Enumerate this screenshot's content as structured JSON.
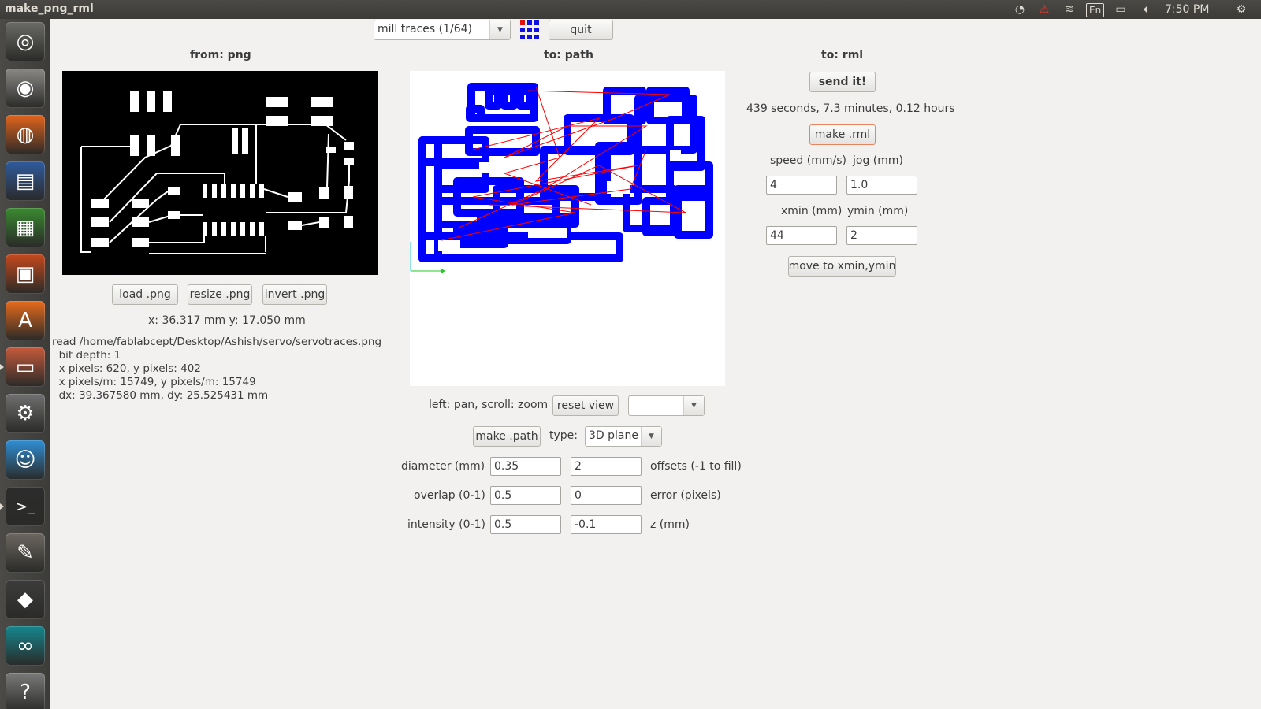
{
  "window": {
    "title": "make_png_rml"
  },
  "tray": {
    "language": "En",
    "clock": "7:50 PM"
  },
  "launcher": {
    "items": [
      {
        "name": "ubuntu-dash-icon",
        "glyph": "◎",
        "color": "#6a6a66"
      },
      {
        "name": "camera-icon",
        "glyph": "◉",
        "color": "#8a8986"
      },
      {
        "name": "firefox-icon",
        "glyph": "◍",
        "color": "#e2641c"
      },
      {
        "name": "writer-icon",
        "glyph": "▤",
        "color": "#2f5b9c"
      },
      {
        "name": "calc-icon",
        "glyph": "▦",
        "color": "#3a8a30"
      },
      {
        "name": "impress-icon",
        "glyph": "▣",
        "color": "#c4491c"
      },
      {
        "name": "software-center-icon",
        "glyph": "A",
        "color": "#e86b1c"
      },
      {
        "name": "file-manager-icon",
        "glyph": "▭",
        "color": "#c45a3c"
      },
      {
        "name": "system-settings-icon",
        "glyph": "⚙",
        "color": "#707070"
      },
      {
        "name": "chat-icon",
        "glyph": "☺",
        "color": "#2f8ed4"
      },
      {
        "name": "terminal-icon",
        "glyph": ">_",
        "color": "#2c2c2c"
      },
      {
        "name": "gimp-icon",
        "glyph": "✎",
        "color": "#6c6860"
      },
      {
        "name": "inkscape-icon",
        "glyph": "◆",
        "color": "#3c3c3c"
      },
      {
        "name": "arduino-icon",
        "glyph": "∞",
        "color": "#15868d"
      },
      {
        "name": "help-icon",
        "glyph": "?",
        "color": "#7a7a7a"
      }
    ]
  },
  "toolbar": {
    "process": "mill traces (1/64)",
    "quit_label": "quit"
  },
  "png_panel": {
    "header": "from: png",
    "load_label": "load .png",
    "resize_label": "resize .png",
    "invert_label": "invert .png",
    "coords": "x: 36.317 mm  y: 17.050 mm",
    "info": [
      "read /home/fablabcept/Desktop/Ashish/servo/servotraces.png",
      "  bit depth: 1",
      "  x pixels: 620, y pixels: 402",
      "  x pixels/m: 15749, y pixels/m: 15749",
      "  dx: 39.367580 mm, dy: 25.525431 mm"
    ]
  },
  "path_panel": {
    "header": "to: path",
    "view_hint": "left: pan, scroll: zoom",
    "reset_view_label": "reset view",
    "view_select": "",
    "make_path_label": "make .path",
    "type_label": "type:",
    "type_value": "3D plane",
    "diameter_label": "diameter (mm)",
    "diameter_value": "0.35",
    "offsets_value": "2",
    "offsets_label": "offsets (-1 to fill)",
    "overlap_label": "overlap (0-1)",
    "overlap_value": "0.5",
    "error_value": "0",
    "error_label": "error (pixels)",
    "intensity_label": "intensity (0-1)",
    "intensity_value": "0.5",
    "z_value": "-0.1",
    "z_label": "z (mm)",
    "colors": {
      "toolpath": "#0000ff",
      "moves": "#ff0000",
      "axis_x": "#22cc22",
      "axis_y": "#22cccc"
    }
  },
  "rml_panel": {
    "header": "to: rml",
    "send_label": "send it!",
    "time_estimate": "439 seconds, 7.3 minutes, 0.12 hours",
    "make_rml_label": "make .rml",
    "speed_label": "speed (mm/s)",
    "jog_label": "jog (mm)",
    "speed_value": "4",
    "jog_value": "1.0",
    "xmin_label": "xmin (mm)",
    "ymin_label": "ymin (mm)",
    "xmin_value": "44",
    "ymin_value": "2",
    "move_label": "move to xmin,ymin"
  }
}
